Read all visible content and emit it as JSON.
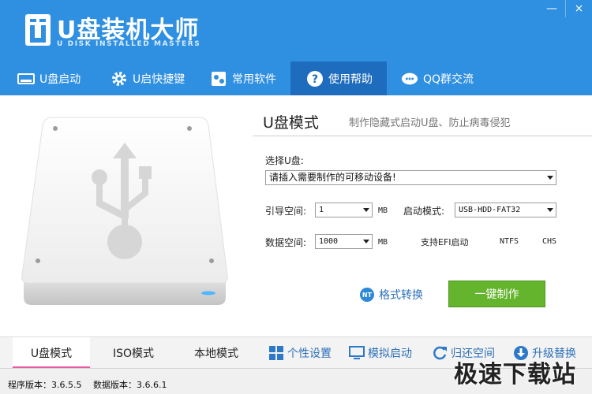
{
  "app": {
    "title": "U盘装机大师",
    "subtitle": "U DISK INSTALLED MASTERS",
    "brand_color": "#2f8fe0"
  },
  "window": {
    "minimize": "—",
    "close": "×"
  },
  "nav": {
    "items": [
      {
        "label": "U盘启动",
        "icon": "usb-drive-icon"
      },
      {
        "label": "U启快捷键",
        "icon": "gear-icon"
      },
      {
        "label": "常用软件",
        "icon": "software-icon"
      },
      {
        "label": "使用帮助",
        "icon": "help-icon"
      },
      {
        "label": "QQ群交流",
        "icon": "qq-icon"
      }
    ],
    "active": "使用帮助"
  },
  "main": {
    "mode_title": "U盘模式",
    "mode_desc": "制作隐藏式启动U盘、防止病毒侵犯",
    "select_disk_label": "选择U盘:",
    "select_disk_value": "请插入需要制作的可移动设备!",
    "boot_space_label": "引导空间:",
    "boot_space_value": "1",
    "boot_space_unit": "MB",
    "boot_mode_label": "启动模式:",
    "boot_mode_value": "USB-HDD-FAT32",
    "data_space_label": "数据空间:",
    "data_space_value": "1000",
    "data_space_unit": "MB",
    "efi_label": "支持EFI启动",
    "fs_ntfs": "NTFS",
    "fs_chs": "CHS",
    "format_convert": "格式转换",
    "format_badge": "NT",
    "make_button": "一键制作"
  },
  "bottom": {
    "tabs": [
      "U盘模式",
      "ISO模式",
      "本地模式"
    ],
    "active_tab": "U盘模式",
    "actions": [
      {
        "label": "个性设置",
        "icon": "grid-icon"
      },
      {
        "label": "模拟启动",
        "icon": "monitor-icon"
      },
      {
        "label": "归还空间",
        "icon": "refresh-icon"
      },
      {
        "label": "升级替换",
        "icon": "download-icon"
      }
    ]
  },
  "status": {
    "program_version": "程序版本：3.6.5.5",
    "data_version": "数据版本：3.6.6.1"
  },
  "watermark": "极速下载站"
}
